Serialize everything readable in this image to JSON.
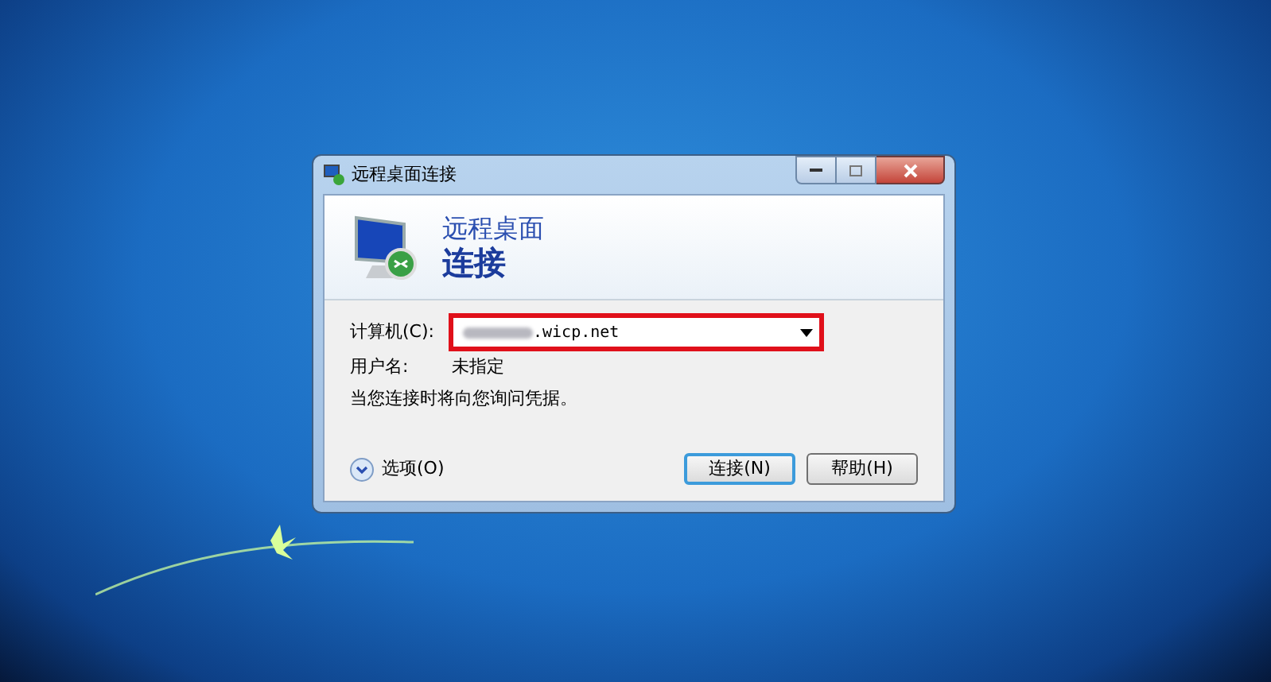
{
  "window": {
    "title": "远程桌面连接"
  },
  "banner": {
    "line_1": "远程桌面",
    "line_2": "连接"
  },
  "computer": {
    "label": "计算机(C):",
    "value": ".wicp.net"
  },
  "username": {
    "label": "用户名:",
    "value": "未指定"
  },
  "note": "当您连接时将向您询问凭据。",
  "options": {
    "label": "选项(O)",
    "expanded": false
  },
  "buttons": [
    {
      "label": "连接(N)",
      "default": true
    },
    {
      "label": "帮助(H)",
      "default": false
    }
  ]
}
